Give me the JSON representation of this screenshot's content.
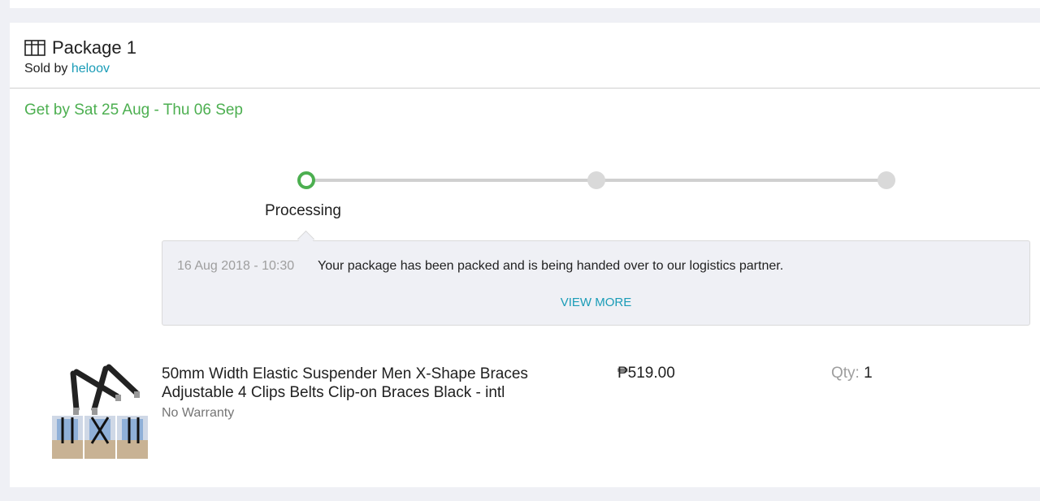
{
  "package": {
    "title": "Package 1",
    "sold_by_label": "Sold by",
    "seller": "heloov",
    "delivery_estimate": "Get by Sat 25 Aug - Thu 06 Sep"
  },
  "tracking": {
    "steps_total": 3,
    "current_step": 1,
    "current_step_label": "Processing",
    "colors": {
      "active": "#4caf50",
      "inactive": "#d9d9d9"
    },
    "event": {
      "time": "16 Aug 2018 - 10:30",
      "message": "Your package has been packed and is being handed over to our logistics partner.",
      "view_more_label": "VIEW MORE"
    }
  },
  "item": {
    "name": "50mm Width Elastic Suspender Men X-Shape Braces Adjustable 4 Clips Belts Clip-on Braces Black - intl",
    "warranty": "No Warranty",
    "price": "₱519.00",
    "qty_label": "Qty:",
    "qty": "1"
  },
  "colors": {
    "accent_link": "#1a9cb7",
    "delivery_green": "#4caf50",
    "page_bg": "#eff0f5"
  }
}
